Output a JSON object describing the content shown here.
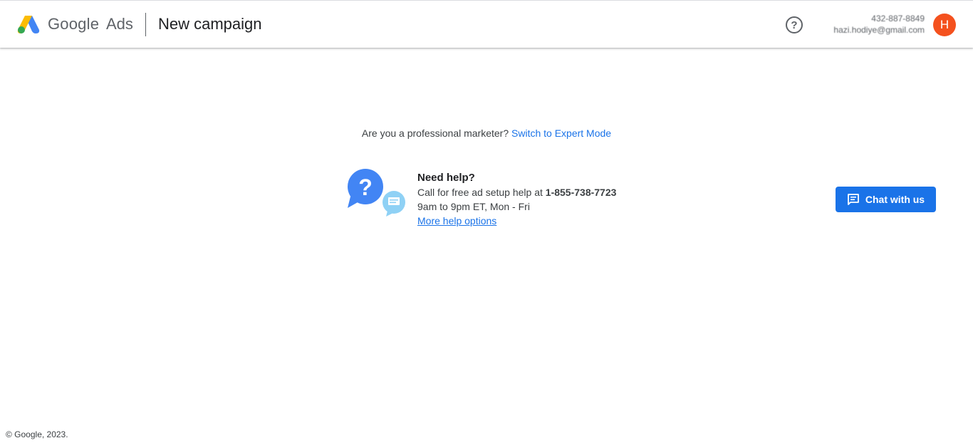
{
  "header": {
    "logo_google": "Google",
    "logo_ads": "Ads",
    "page_title": "New campaign",
    "help_icon": "help-circle-icon",
    "account_id": "432-887-8849",
    "account_email": "hazi.hodiye@gmail.com",
    "avatar_letter": "H",
    "avatar_color": "#f4511e"
  },
  "main": {
    "expert_prompt": "Are you a professional marketer?",
    "expert_link": "Switch to Expert Mode",
    "help": {
      "illustration": "help-chat-bubbles-icon",
      "title": "Need help?",
      "call_text": "Call for free ad setup help at",
      "phone": "1-855-738-7723",
      "hours": "9am to 9pm ET, Mon - Fri",
      "more_link": "More help options"
    },
    "chat_button": {
      "icon": "chat-icon",
      "label": "Chat with us"
    }
  },
  "footer": {
    "copyright": "© Google, 2023."
  },
  "colors": {
    "accent": "#1a73e8",
    "avatar": "#f4511e"
  }
}
